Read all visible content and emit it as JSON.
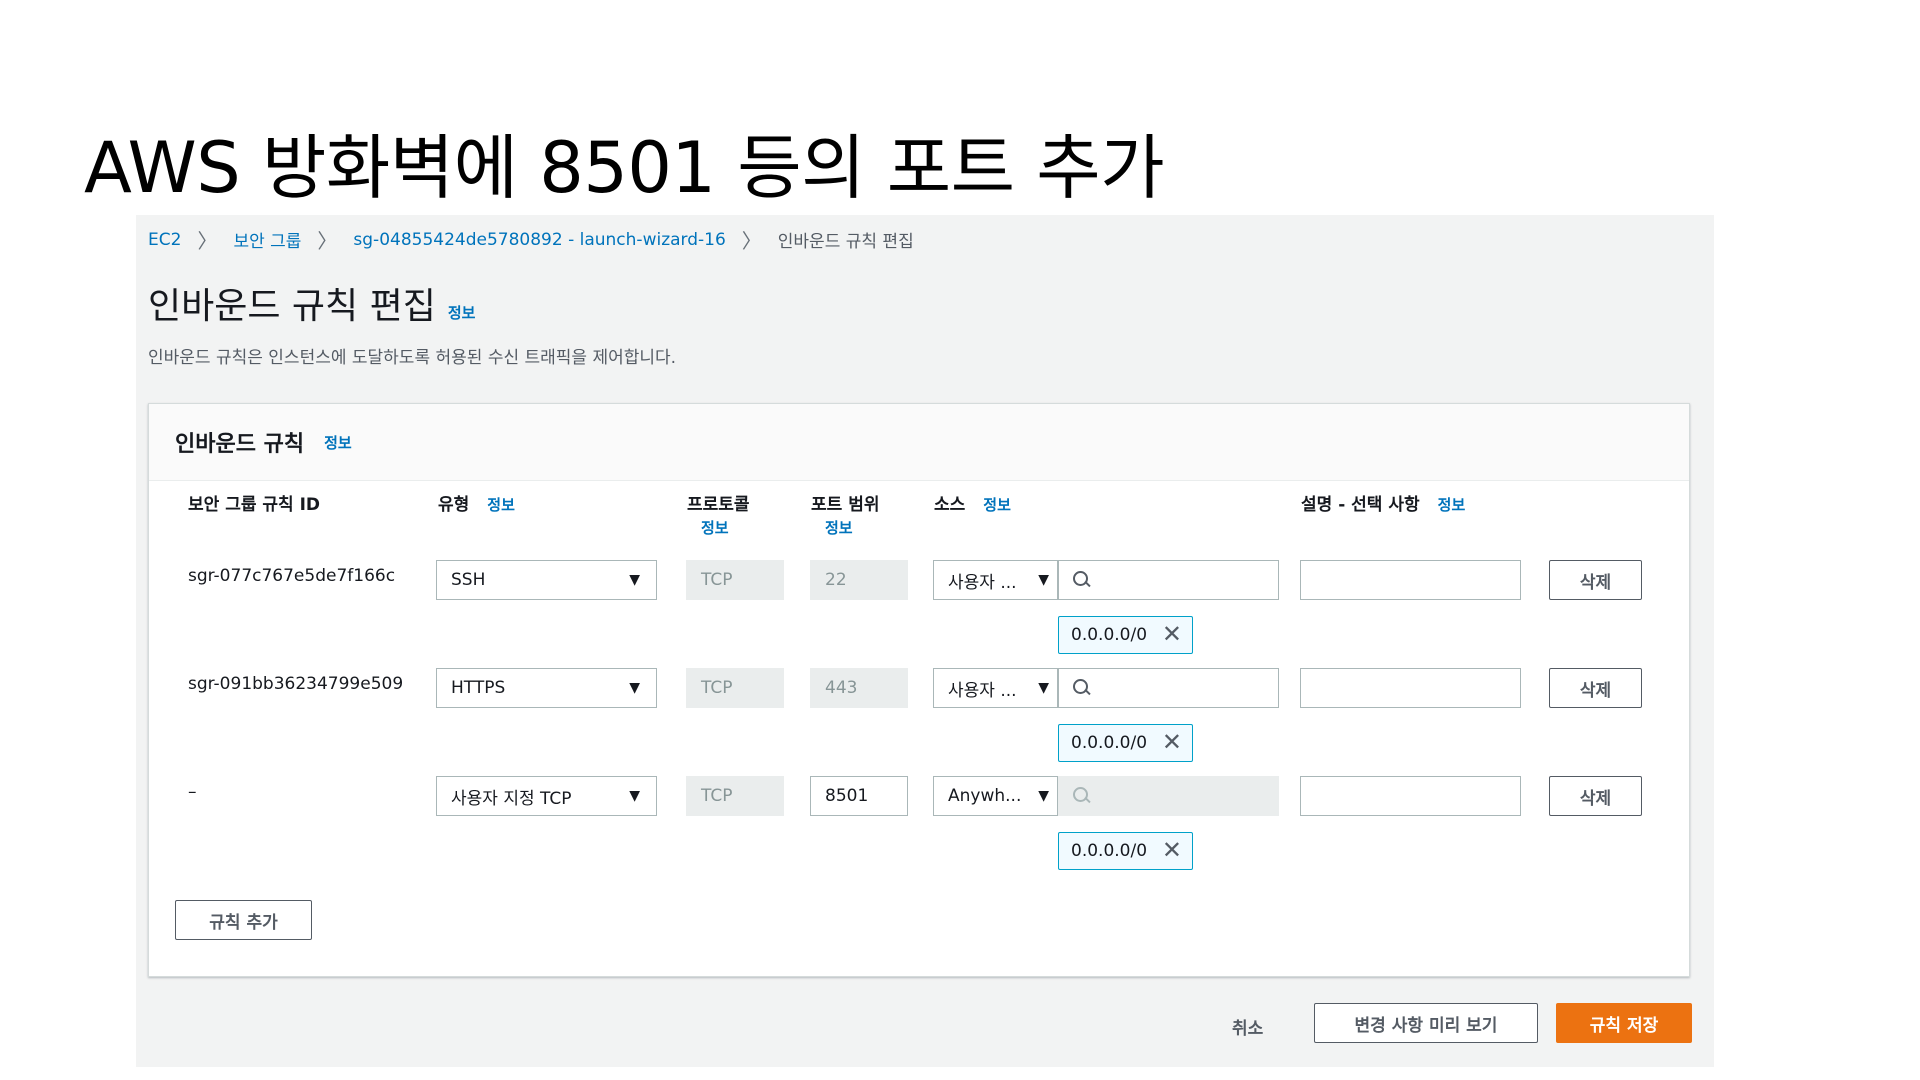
{
  "slide": {
    "title": "AWS 방화벽에 8501 등의 포트 추가"
  },
  "breadcrumb": {
    "items": [
      "EC2",
      "보안 그룹",
      "sg-04855424de5780892 - launch-wizard-16",
      "인바운드 규칙 편집"
    ],
    "separator": "〉"
  },
  "page": {
    "heading": "인바운드 규칙 편집",
    "info": "정보",
    "description": "인바운드 규칙은 인스턴스에 도달하도록 허용된 수신 트래픽을 제어합니다."
  },
  "panel": {
    "title": "인바운드 규칙",
    "info": "정보",
    "columns": {
      "rule_id": "보안 그룹 규칙 ID",
      "type": "유형",
      "protocol": "프로토콜",
      "port_range": "포트 범위",
      "source": "소스",
      "description": "설명 - 선택 사항",
      "info": "정보"
    },
    "rows": [
      {
        "id": "sgr-077c767e5de7f166c",
        "type": "SSH",
        "protocol": "TCP",
        "port": "22",
        "source_type": "사용자 ...",
        "source_search": "",
        "cidr": "0.0.0.0/0",
        "description": "",
        "delete": "삭제"
      },
      {
        "id": "sgr-091bb36234799e509",
        "type": "HTTPS",
        "protocol": "TCP",
        "port": "443",
        "source_type": "사용자 ...",
        "source_search": "",
        "cidr": "0.0.0.0/0",
        "description": "",
        "delete": "삭제"
      },
      {
        "id": "–",
        "type": "사용자 지정 TCP",
        "protocol": "TCP",
        "port": "8501",
        "source_type": "Anywh...",
        "source_search": "",
        "cidr": "0.0.0.0/0",
        "description": "",
        "delete": "삭제"
      }
    ],
    "add_rule": "규칙 추가"
  },
  "footer": {
    "cancel": "취소",
    "preview": "변경 사항 미리 보기",
    "save": "규칙 저장"
  },
  "colors": {
    "link": "#0073bb",
    "primary": "#ec7211",
    "token_border": "#00a1c9",
    "background": "#f2f3f3"
  },
  "icons": {
    "dropdown": "caret-down-icon",
    "search": "search-icon",
    "remove": "close-icon",
    "breadcrumb": "chevron-right-icon"
  }
}
